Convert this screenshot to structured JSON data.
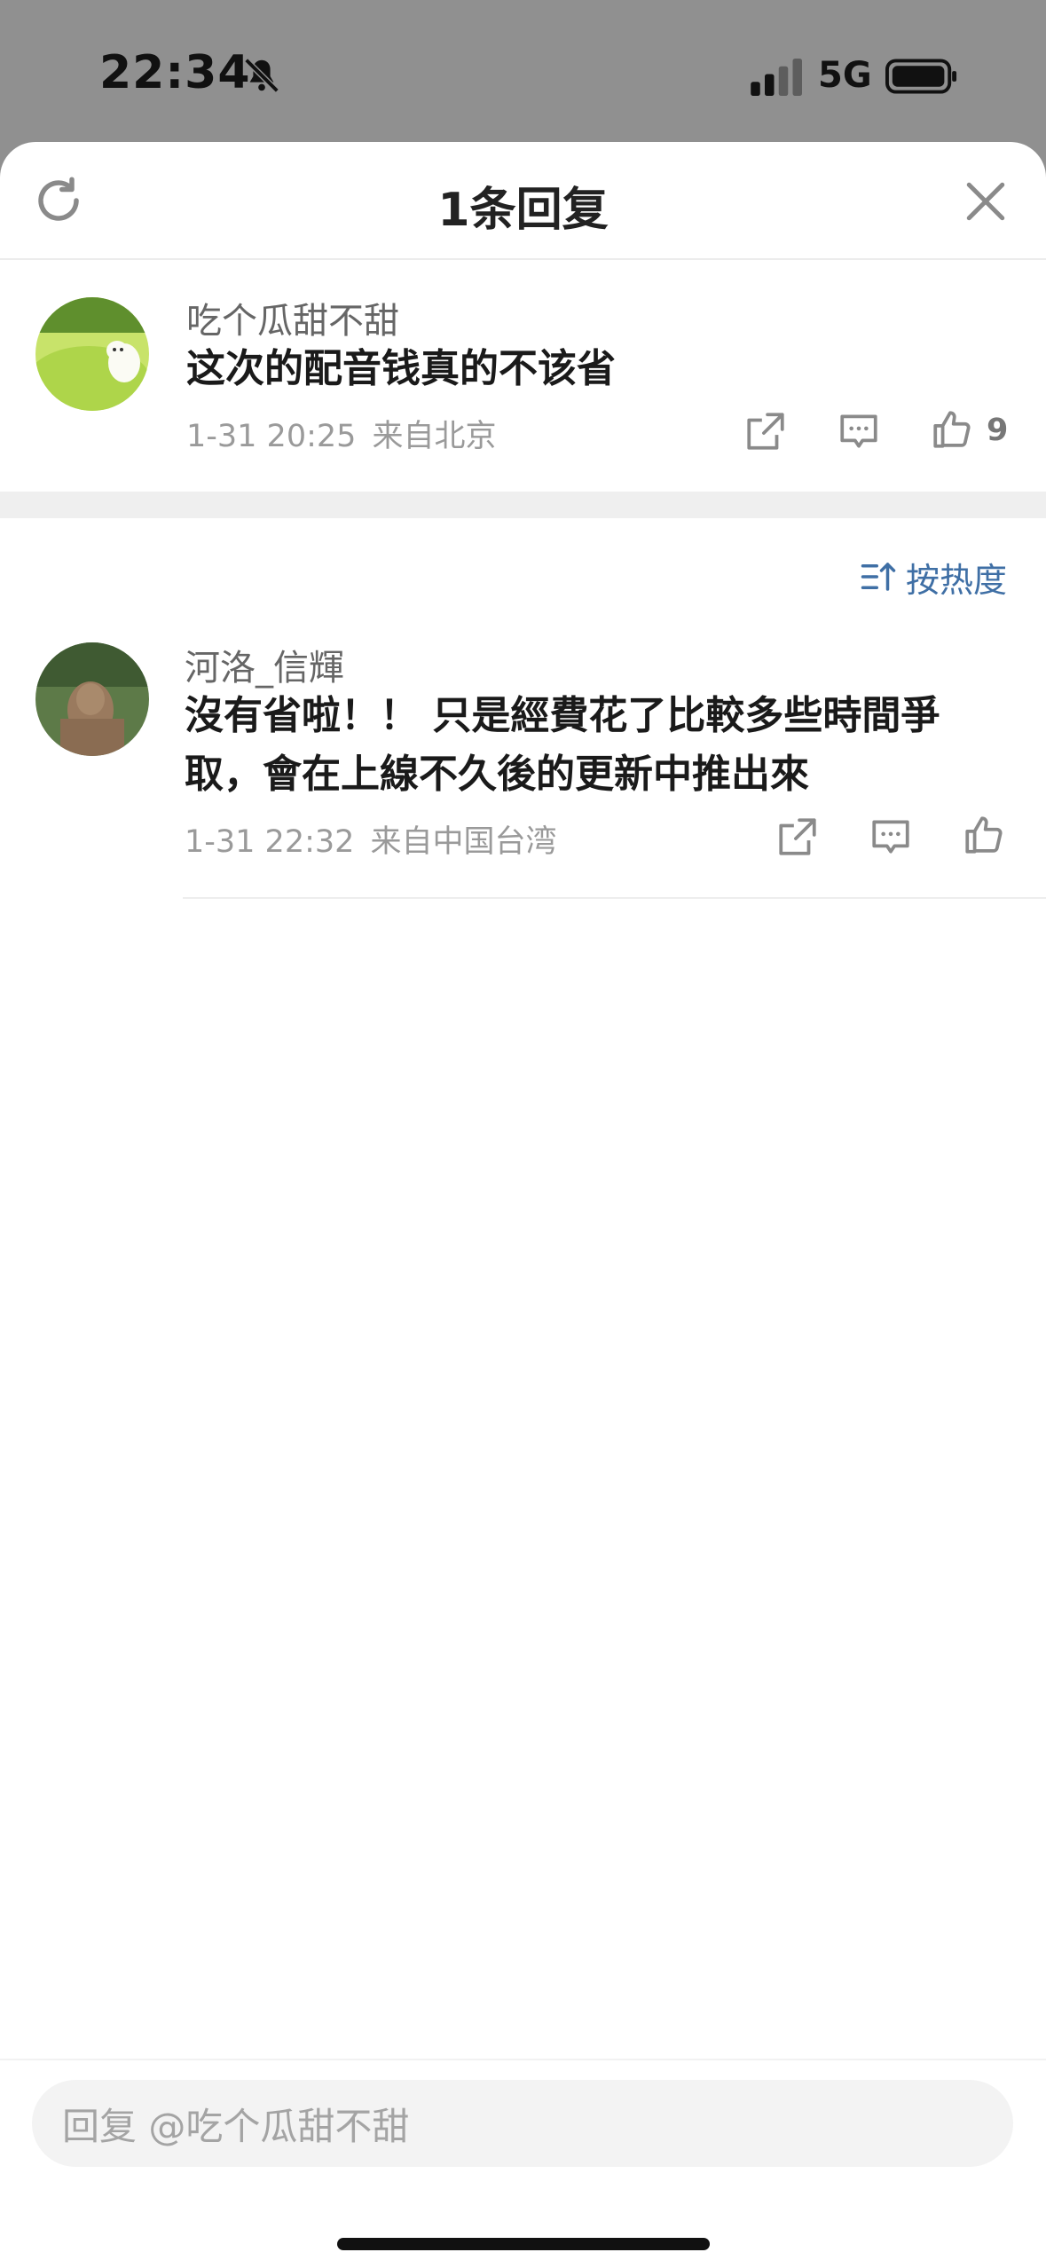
{
  "status": {
    "time": "22:34",
    "network": "5G"
  },
  "header": {
    "title": "1条回复"
  },
  "root_comment": {
    "user": "吃个瓜甜不甜",
    "text": "这次的配音钱真的不该省",
    "time": "1-31 20:25",
    "location": "来自北京",
    "likes": "9"
  },
  "sort": {
    "label": "按热度"
  },
  "replies": [
    {
      "user": "河洛_信輝",
      "text_line1": "沒有省啦！！ 只是經費花了比較多些時間爭",
      "text_line2": "取，會在上線不久後的更新中推出來",
      "time": "1-31 22:32",
      "location": "来自中国台湾"
    }
  ],
  "reply_box": {
    "placeholder": "回复 @吃个瓜甜不甜"
  },
  "colors": {
    "accent": "#3f6fa5",
    "icon": "#8a8a8a"
  },
  "icons": {
    "refresh": "refresh-icon",
    "close": "close-icon",
    "share": "share-icon",
    "comment": "comment-icon",
    "like": "thumbs-up-icon",
    "sort": "sort-icon",
    "mute": "bell-slash-icon",
    "signal": "signal-icon",
    "battery": "battery-icon"
  }
}
